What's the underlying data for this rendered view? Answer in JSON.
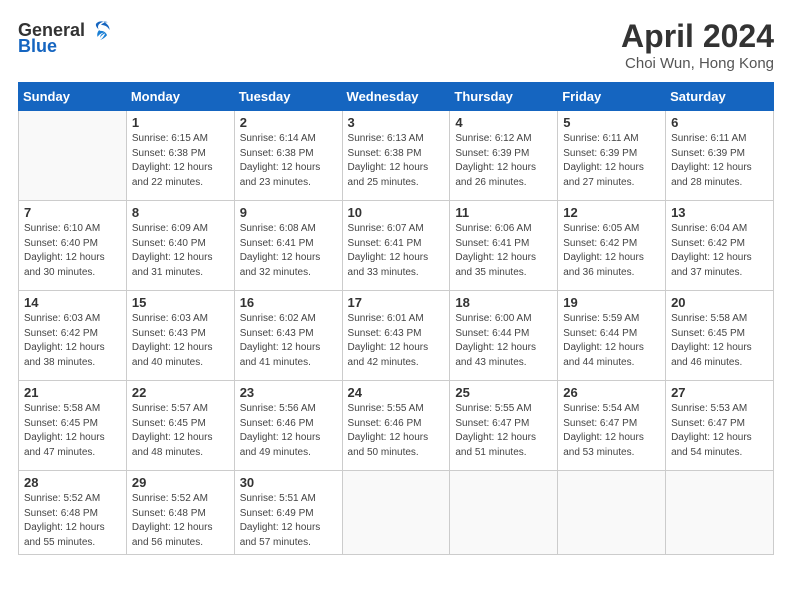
{
  "header": {
    "logo_general": "General",
    "logo_blue": "Blue",
    "title": "April 2024",
    "location": "Choi Wun, Hong Kong"
  },
  "weekdays": [
    "Sunday",
    "Monday",
    "Tuesday",
    "Wednesday",
    "Thursday",
    "Friday",
    "Saturday"
  ],
  "weeks": [
    [
      {
        "day": "",
        "info": ""
      },
      {
        "day": "1",
        "info": "Sunrise: 6:15 AM\nSunset: 6:38 PM\nDaylight: 12 hours\nand 22 minutes."
      },
      {
        "day": "2",
        "info": "Sunrise: 6:14 AM\nSunset: 6:38 PM\nDaylight: 12 hours\nand 23 minutes."
      },
      {
        "day": "3",
        "info": "Sunrise: 6:13 AM\nSunset: 6:38 PM\nDaylight: 12 hours\nand 25 minutes."
      },
      {
        "day": "4",
        "info": "Sunrise: 6:12 AM\nSunset: 6:39 PM\nDaylight: 12 hours\nand 26 minutes."
      },
      {
        "day": "5",
        "info": "Sunrise: 6:11 AM\nSunset: 6:39 PM\nDaylight: 12 hours\nand 27 minutes."
      },
      {
        "day": "6",
        "info": "Sunrise: 6:11 AM\nSunset: 6:39 PM\nDaylight: 12 hours\nand 28 minutes."
      }
    ],
    [
      {
        "day": "7",
        "info": "Sunrise: 6:10 AM\nSunset: 6:40 PM\nDaylight: 12 hours\nand 30 minutes."
      },
      {
        "day": "8",
        "info": "Sunrise: 6:09 AM\nSunset: 6:40 PM\nDaylight: 12 hours\nand 31 minutes."
      },
      {
        "day": "9",
        "info": "Sunrise: 6:08 AM\nSunset: 6:41 PM\nDaylight: 12 hours\nand 32 minutes."
      },
      {
        "day": "10",
        "info": "Sunrise: 6:07 AM\nSunset: 6:41 PM\nDaylight: 12 hours\nand 33 minutes."
      },
      {
        "day": "11",
        "info": "Sunrise: 6:06 AM\nSunset: 6:41 PM\nDaylight: 12 hours\nand 35 minutes."
      },
      {
        "day": "12",
        "info": "Sunrise: 6:05 AM\nSunset: 6:42 PM\nDaylight: 12 hours\nand 36 minutes."
      },
      {
        "day": "13",
        "info": "Sunrise: 6:04 AM\nSunset: 6:42 PM\nDaylight: 12 hours\nand 37 minutes."
      }
    ],
    [
      {
        "day": "14",
        "info": "Sunrise: 6:03 AM\nSunset: 6:42 PM\nDaylight: 12 hours\nand 38 minutes."
      },
      {
        "day": "15",
        "info": "Sunrise: 6:03 AM\nSunset: 6:43 PM\nDaylight: 12 hours\nand 40 minutes."
      },
      {
        "day": "16",
        "info": "Sunrise: 6:02 AM\nSunset: 6:43 PM\nDaylight: 12 hours\nand 41 minutes."
      },
      {
        "day": "17",
        "info": "Sunrise: 6:01 AM\nSunset: 6:43 PM\nDaylight: 12 hours\nand 42 minutes."
      },
      {
        "day": "18",
        "info": "Sunrise: 6:00 AM\nSunset: 6:44 PM\nDaylight: 12 hours\nand 43 minutes."
      },
      {
        "day": "19",
        "info": "Sunrise: 5:59 AM\nSunset: 6:44 PM\nDaylight: 12 hours\nand 44 minutes."
      },
      {
        "day": "20",
        "info": "Sunrise: 5:58 AM\nSunset: 6:45 PM\nDaylight: 12 hours\nand 46 minutes."
      }
    ],
    [
      {
        "day": "21",
        "info": "Sunrise: 5:58 AM\nSunset: 6:45 PM\nDaylight: 12 hours\nand 47 minutes."
      },
      {
        "day": "22",
        "info": "Sunrise: 5:57 AM\nSunset: 6:45 PM\nDaylight: 12 hours\nand 48 minutes."
      },
      {
        "day": "23",
        "info": "Sunrise: 5:56 AM\nSunset: 6:46 PM\nDaylight: 12 hours\nand 49 minutes."
      },
      {
        "day": "24",
        "info": "Sunrise: 5:55 AM\nSunset: 6:46 PM\nDaylight: 12 hours\nand 50 minutes."
      },
      {
        "day": "25",
        "info": "Sunrise: 5:55 AM\nSunset: 6:47 PM\nDaylight: 12 hours\nand 51 minutes."
      },
      {
        "day": "26",
        "info": "Sunrise: 5:54 AM\nSunset: 6:47 PM\nDaylight: 12 hours\nand 53 minutes."
      },
      {
        "day": "27",
        "info": "Sunrise: 5:53 AM\nSunset: 6:47 PM\nDaylight: 12 hours\nand 54 minutes."
      }
    ],
    [
      {
        "day": "28",
        "info": "Sunrise: 5:52 AM\nSunset: 6:48 PM\nDaylight: 12 hours\nand 55 minutes."
      },
      {
        "day": "29",
        "info": "Sunrise: 5:52 AM\nSunset: 6:48 PM\nDaylight: 12 hours\nand 56 minutes."
      },
      {
        "day": "30",
        "info": "Sunrise: 5:51 AM\nSunset: 6:49 PM\nDaylight: 12 hours\nand 57 minutes."
      },
      {
        "day": "",
        "info": ""
      },
      {
        "day": "",
        "info": ""
      },
      {
        "day": "",
        "info": ""
      },
      {
        "day": "",
        "info": ""
      }
    ]
  ]
}
